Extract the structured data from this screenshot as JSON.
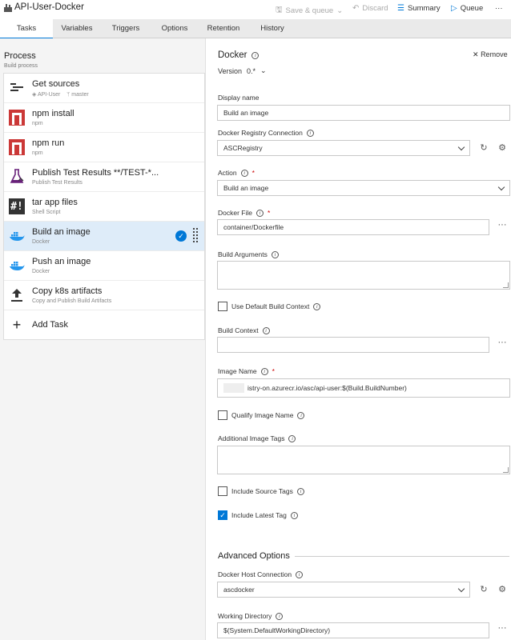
{
  "app": {
    "title": "API-User-Docker",
    "actions": {
      "save_queue": "Save & queue",
      "discard": "Discard",
      "summary": "Summary",
      "queue": "Queue",
      "more": "···"
    }
  },
  "tabs": [
    "Tasks",
    "Variables",
    "Triggers",
    "Options",
    "Retention",
    "History"
  ],
  "process": {
    "title": "Process",
    "subtitle": "Build process"
  },
  "tasks": [
    {
      "name": "Get sources",
      "sub_repo": "API-User",
      "sub_branch": "master"
    },
    {
      "name": "npm install",
      "sub": "npm"
    },
    {
      "name": "npm run",
      "sub": "npm"
    },
    {
      "name": "Publish Test Results **/TEST-*...",
      "sub": "Publish Test Results"
    },
    {
      "name": "tar app files",
      "sub": "Shell Script"
    },
    {
      "name": "Build an image",
      "sub": "Docker"
    },
    {
      "name": "Push an image",
      "sub": "Docker"
    },
    {
      "name": "Copy k8s artifacts",
      "sub": "Copy and Publish Build Artifacts"
    }
  ],
  "add_task": "Add Task",
  "detail": {
    "title": "Docker",
    "remove": "Remove",
    "version_label": "Version",
    "version_value": "0.*",
    "display_name_label": "Display name",
    "display_name_value": "Build an image",
    "registry_label": "Docker Registry Connection",
    "registry_value": "ASCRegistry",
    "action_label": "Action",
    "action_value": "Build an image",
    "docker_file_label": "Docker File",
    "docker_file_value": "container/Dockerfile",
    "build_args_label": "Build Arguments",
    "use_default_ctx_label": "Use Default Build Context",
    "build_ctx_label": "Build Context",
    "image_name_label": "Image Name",
    "image_name_value": "istry-on.azurecr.io/asc/api-user:$(Build.BuildNumber)",
    "qualify_label": "Qualify Image Name",
    "additional_tags_label": "Additional Image Tags",
    "include_source_tags_label": "Include Source Tags",
    "include_latest_tag_label": "Include Latest Tag",
    "advanced_title": "Advanced Options",
    "host_conn_label": "Docker Host Connection",
    "host_conn_value": "ascdocker",
    "working_dir_label": "Working Directory",
    "working_dir_value": "$(System.DefaultWorkingDirectory)"
  },
  "colors": {
    "accent": "#0078d7",
    "npm": "#cb3837",
    "selected_row": "#deecf9",
    "required": "#cc0000"
  }
}
